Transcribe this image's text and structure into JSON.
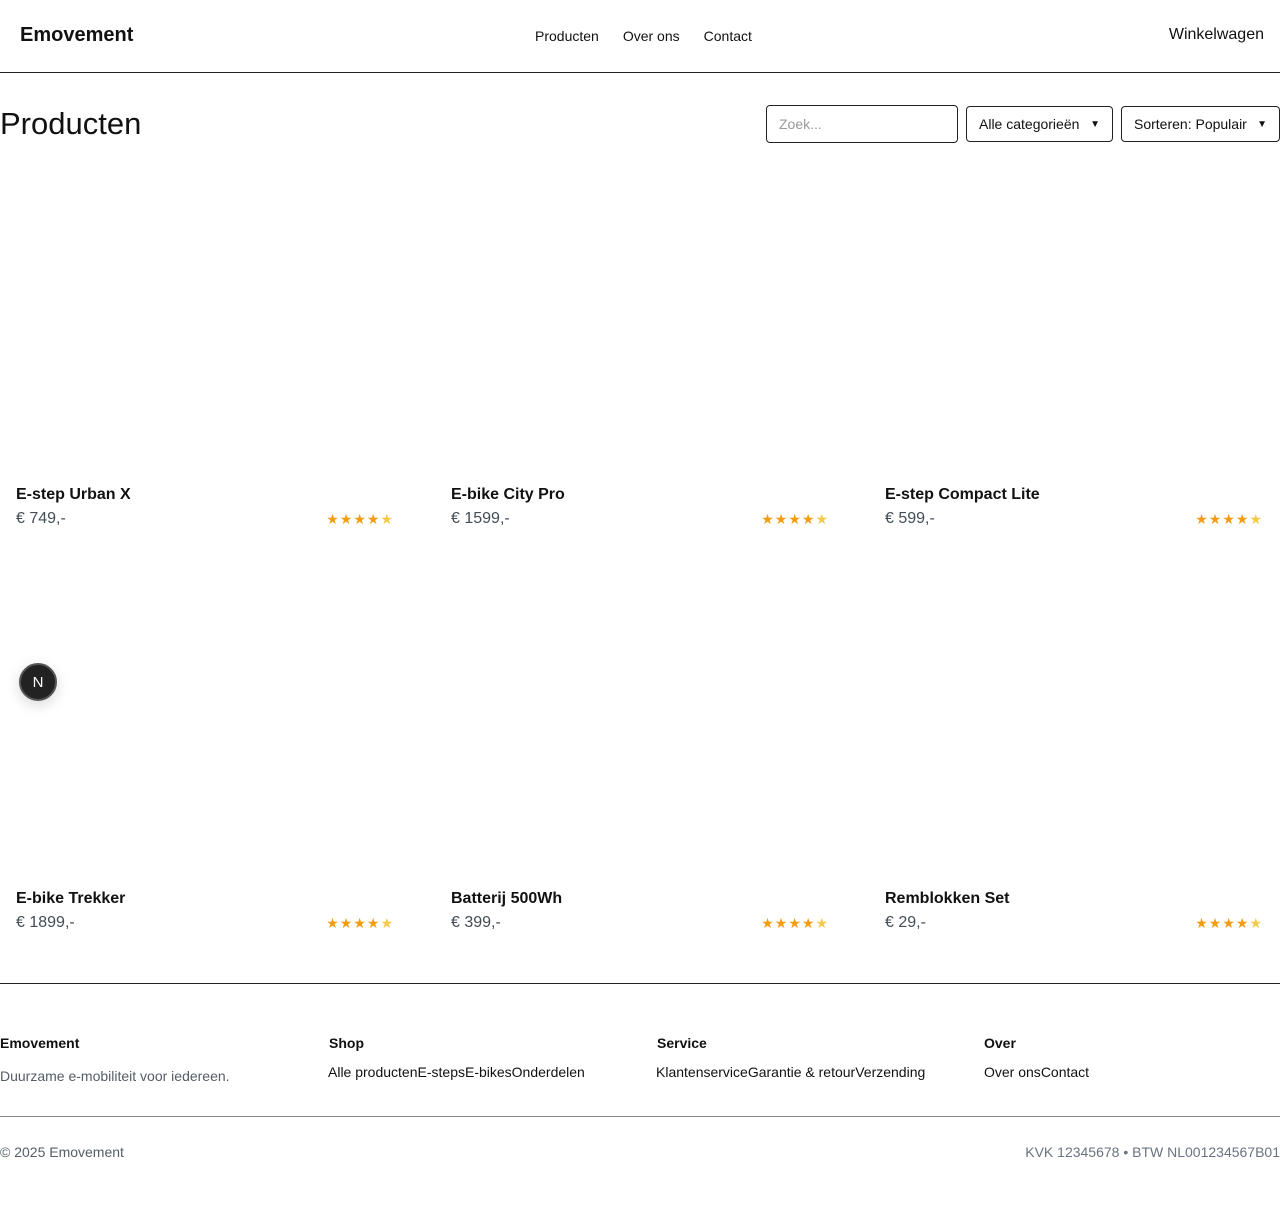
{
  "header": {
    "brand": "Emovement",
    "nav": [
      "Producten",
      "Over ons",
      "Contact"
    ],
    "cart_label": "Winkelwagen"
  },
  "toolbar": {
    "title": "Producten",
    "search_placeholder": "Zoek...",
    "category_selected": "Alle categorieën",
    "sort_selected": "Sorteren: Populair"
  },
  "products": [
    {
      "name": "E-step Urban X",
      "price": "€ 749,-",
      "rating": 4.5,
      "stars": "★★★★★"
    },
    {
      "name": "E-bike City Pro",
      "price": "€ 1599,-",
      "rating": 4.5,
      "stars": "★★★★★"
    },
    {
      "name": "E-step Compact Lite",
      "price": "€ 599,-",
      "rating": 4.5,
      "stars": "★★★★★"
    },
    {
      "name": "E-bike Trekker",
      "price": "€ 1899,-",
      "rating": 4.5,
      "stars": "★★★★★"
    },
    {
      "name": "Batterij 500Wh",
      "price": "€ 399,-",
      "rating": 4.5,
      "stars": "★★★★★"
    },
    {
      "name": "Remblokken Set",
      "price": "€ 29,-",
      "rating": 4.5,
      "stars": "★★★★★"
    }
  ],
  "badge": "N",
  "footer": {
    "brand": {
      "title": "Emovement",
      "desc": "Duurzame e-mobiliteit voor iedereen."
    },
    "shop": {
      "title": "Shop",
      "links": [
        "Alle producten",
        "E-steps",
        "E-bikes",
        "Onderdelen"
      ]
    },
    "service": {
      "title": "Service",
      "links": [
        "Klantenservice",
        "Garantie & retour",
        "Verzending"
      ]
    },
    "over": {
      "title": "Over",
      "links": [
        "Over ons",
        "Contact"
      ]
    },
    "copyright": "© 2025 Emovement",
    "legal": "KVK 12345678 • BTW NL001234567B01"
  },
  "colors": {
    "star": "#f39c12",
    "star_half": "#f7c948",
    "text_muted": "#555d66"
  }
}
